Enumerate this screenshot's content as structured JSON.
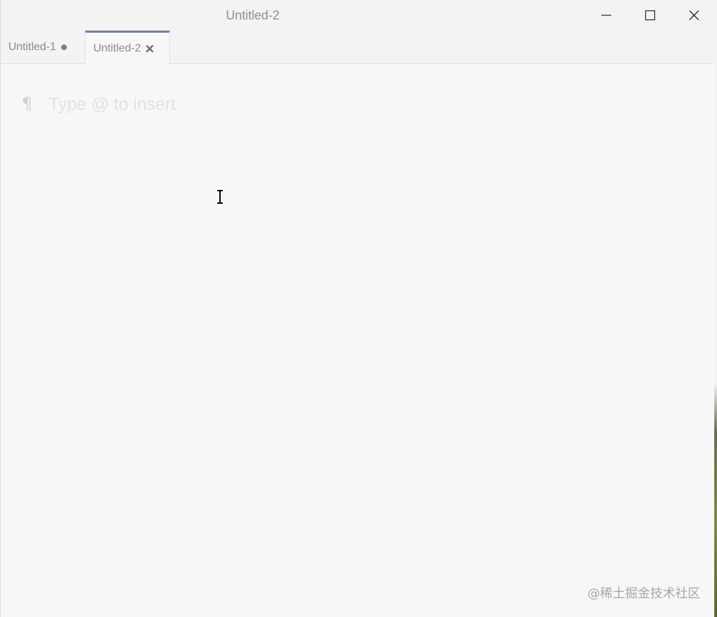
{
  "window": {
    "title": "Untitled-2"
  },
  "tabs": [
    {
      "label": "Untitled-1",
      "state": "modified"
    },
    {
      "label": "Untitled-2",
      "state": "active"
    }
  ],
  "editor": {
    "paragraph_icon": "¶",
    "placeholder": "Type @ to insert"
  },
  "watermark": "@稀土掘金技术社区",
  "colors": {
    "accent": "#6b7fa8",
    "background": "#f7f7f7",
    "titlebar": "#f3f3f3"
  },
  "icons": {
    "minimize": "minimize-icon",
    "maximize": "maximize-icon",
    "close": "close-icon",
    "tab_close": "x-icon",
    "modified": "dot-icon",
    "cursor": "text-cursor-icon"
  }
}
